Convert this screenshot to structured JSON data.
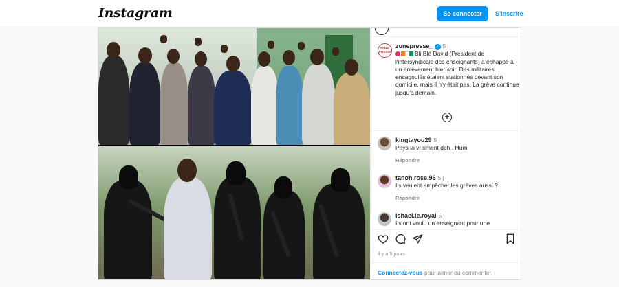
{
  "header": {
    "logo": "Instagram",
    "login_button": "Se connecter",
    "signup_link": "S'inscrire"
  },
  "post": {
    "author": {
      "username": "zonepresse_",
      "time": "5 j",
      "avatar_text": "ZONE PRESSE"
    },
    "caption": "Bli Blé David (Président de l'intersyndicale des enseignants) a échappé à un enlèvement hier soir. Des militaires encagoulés étaient stationnés devant son domicile, mais il n'y était pas. La grève continue jusqu'à demain.",
    "comments": [
      {
        "username": "kingtayou29",
        "time": "5 j",
        "text": "Pays là vraiment deh . Hum",
        "reply": "Répondre"
      },
      {
        "username": "tanoh.rose.96",
        "time": "5 j",
        "text": "Ils veulent empêcher les grèves aussi ?",
        "reply": "Répondre"
      },
      {
        "username": "ishael.le.royal",
        "time": "5 j",
        "text": "Ils ont voulu un enseignant pour une",
        "reply": ""
      }
    ],
    "date": "il y a 5 jours",
    "login_prompt_link": "Connectez-vous",
    "login_prompt_rest": " pour aimer ou commenter."
  },
  "icons": {
    "like": "heart-icon",
    "comment": "comment-icon",
    "share": "send-icon",
    "save": "bookmark-icon",
    "more_comments": "plus-circle-icon"
  },
  "colors": {
    "accent": "#0095f6",
    "text": "#262626",
    "muted": "#8e8e8e"
  }
}
